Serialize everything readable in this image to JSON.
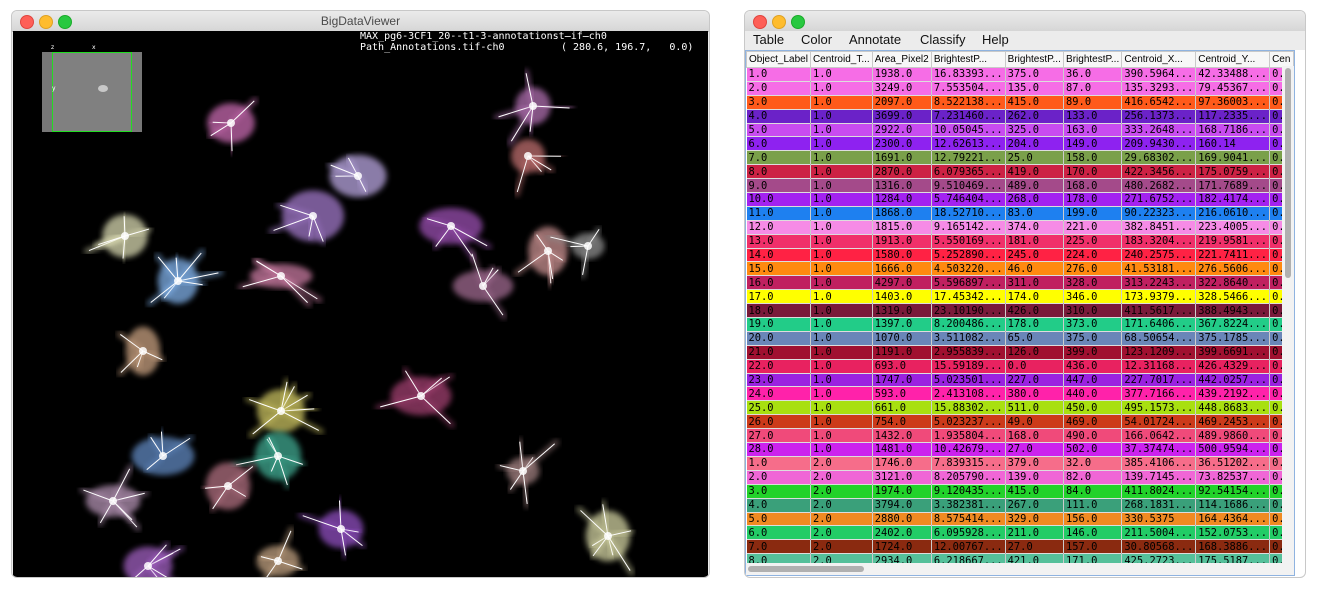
{
  "viewer": {
    "title": "BigDataViewer",
    "overlay_line1": "MAX_pg6-3CF1_20--t1-3-annotationst̶if̶ch0",
    "overlay_line2": "Path_Annotations.tif-ch0",
    "coordinates": "( 280.6, 196.7,   0.0)",
    "minimap": {
      "axis_z": "z",
      "axis_x": "x",
      "axis_y": "y"
    }
  },
  "table_window": {
    "menu": [
      "Table",
      "Color",
      "Annotate",
      "Classify",
      "Help"
    ],
    "columns": [
      "Object_Label",
      "Centroid_T...",
      "Area_Pixel2",
      "BrightestP...",
      "BrightestP...",
      "BrightestP...",
      "Centroid_X...",
      "Centroid_Y...",
      "Cen"
    ],
    "rows": [
      {
        "c": [
          "1.0",
          "1.0",
          "1938.0",
          "16.83393...",
          "375.0",
          "36.0",
          "390.5964...",
          "42.33488...",
          "0.0"
        ],
        "color": "#f66de6"
      },
      {
        "c": [
          "2.0",
          "1.0",
          "3249.0",
          "7.553504...",
          "135.0",
          "87.0",
          "135.3293...",
          "79.45367...",
          "0.0"
        ],
        "color": "#f66de6"
      },
      {
        "c": [
          "3.0",
          "1.0",
          "2097.0",
          "8.522138...",
          "415.0",
          "89.0",
          "416.6542...",
          "97.36003...",
          "0.0"
        ],
        "color": "#ff5a1a"
      },
      {
        "c": [
          "4.0",
          "1.0",
          "3699.0",
          "7.231460...",
          "262.0",
          "133.0",
          "256.1373...",
          "117.2335...",
          "0.0"
        ],
        "color": "#6b22c8"
      },
      {
        "c": [
          "5.0",
          "1.0",
          "2922.0",
          "10.05045...",
          "325.0",
          "163.0",
          "333.2648...",
          "168.7186...",
          "0.0"
        ],
        "color": "#c84cf0"
      },
      {
        "c": [
          "6.0",
          "1.0",
          "2300.0",
          "12.62613...",
          "204.0",
          "149.0",
          "209.9430...",
          "160.14",
          "0.0"
        ],
        "color": "#8e22f0"
      },
      {
        "c": [
          "7.0",
          "1.0",
          "1691.0",
          "12.79221...",
          "25.0",
          "158.0",
          "29.68302...",
          "169.9041...",
          "0.0"
        ],
        "color": "#7aa04a"
      },
      {
        "c": [
          "8.0",
          "1.0",
          "2870.0",
          "6.079365...",
          "419.0",
          "170.0",
          "422.3456...",
          "175.0759...",
          "0.0"
        ],
        "color": "#cc2244"
      },
      {
        "c": [
          "9.0",
          "1.0",
          "1316.0",
          "9.510469...",
          "489.0",
          "168.0",
          "480.2682...",
          "171.7689...",
          "0.0"
        ],
        "color": "#a44a8a"
      },
      {
        "c": [
          "10.0",
          "1.0",
          "1284.0",
          "5.746404...",
          "268.0",
          "178.0",
          "271.6752...",
          "182.4174...",
          "0.0"
        ],
        "color": "#a322f0"
      },
      {
        "c": [
          "11.0",
          "1.0",
          "1868.0",
          "18.52710...",
          "83.0",
          "199.0",
          "90.22323...",
          "216.0610...",
          "0.0"
        ],
        "color": "#1e80f0"
      },
      {
        "c": [
          "12.0",
          "1.0",
          "1815.0",
          "9.165142...",
          "374.0",
          "221.0",
          "382.8451...",
          "223.4005...",
          "0.0"
        ],
        "color": "#f68be6"
      },
      {
        "c": [
          "13.0",
          "1.0",
          "1913.0",
          "5.550169...",
          "181.0",
          "225.0",
          "183.3204...",
          "219.9581...",
          "0.0"
        ],
        "color": "#f0306a"
      },
      {
        "c": [
          "14.0",
          "1.0",
          "1580.0",
          "5.252890...",
          "245.0",
          "224.0",
          "240.2575...",
          "221.7411...",
          "0.0"
        ],
        "color": "#ff2244"
      },
      {
        "c": [
          "15.0",
          "1.0",
          "1666.0",
          "4.503220...",
          "46.0",
          "276.0",
          "41.53181...",
          "276.5606...",
          "0.0"
        ],
        "color": "#ff8a10"
      },
      {
        "c": [
          "16.0",
          "1.0",
          "4297.0",
          "5.596897...",
          "311.0",
          "328.0",
          "313.2243...",
          "322.8640...",
          "0.0"
        ],
        "color": "#c02060"
      },
      {
        "c": [
          "17.0",
          "1.0",
          "1403.0",
          "17.45342...",
          "174.0",
          "346.0",
          "173.9379...",
          "328.5466...",
          "0.0"
        ],
        "color": "#ffff00"
      },
      {
        "c": [
          "18.0",
          "1.0",
          "1319.0",
          "23.10190...",
          "426.0",
          "310.0",
          "411.5617...",
          "388.4943...",
          "0.0"
        ],
        "color": "#7a1a3a"
      },
      {
        "c": [
          "19.0",
          "1.0",
          "1397.0",
          "8.200486...",
          "178.0",
          "373.0",
          "171.6406...",
          "367.8224...",
          "0.0"
        ],
        "color": "#22cc88"
      },
      {
        "c": [
          "20.0",
          "1.0",
          "1070.0",
          "3.511082...",
          "65.0",
          "375.0",
          "68.50654...",
          "375.1785...",
          "0.0"
        ],
        "color": "#6a86b8"
      },
      {
        "c": [
          "21.0",
          "1.0",
          "1191.0",
          "2.955839...",
          "126.0",
          "399.0",
          "123.1209...",
          "399.6691...",
          "0.0"
        ],
        "color": "#a01030"
      },
      {
        "c": [
          "22.0",
          "1.0",
          "693.0",
          "15.59189...",
          "0.0",
          "436.0",
          "12.31168...",
          "426.4329...",
          "0.0"
        ],
        "color": "#e82260"
      },
      {
        "c": [
          "23.0",
          "1.0",
          "1747.0",
          "5.023501...",
          "227.0",
          "447.0",
          "227.7017...",
          "442.0257...",
          "0.0"
        ],
        "color": "#9a22e0"
      },
      {
        "c": [
          "24.0",
          "1.0",
          "593.0",
          "2.413108...",
          "380.0",
          "440.0",
          "377.7166...",
          "439.2192...",
          "0.0"
        ],
        "color": "#ff22aa"
      },
      {
        "c": [
          "25.0",
          "1.0",
          "661.0",
          "15.88302...",
          "511.0",
          "450.0",
          "495.1573...",
          "448.8683...",
          "0.0"
        ],
        "color": "#a8e010"
      },
      {
        "c": [
          "26.0",
          "1.0",
          "754.0",
          "5.023237...",
          "49.0",
          "469.0",
          "54.01724...",
          "469.2453...",
          "0.0"
        ],
        "color": "#cc3a1a"
      },
      {
        "c": [
          "27.0",
          "1.0",
          "1432.0",
          "1.935804...",
          "168.0",
          "490.0",
          "166.0642...",
          "489.9860...",
          "0.0"
        ],
        "color": "#f04a7a"
      },
      {
        "c": [
          "28.0",
          "1.0",
          "1481.0",
          "10.42679...",
          "27.0",
          "502.0",
          "37.37474...",
          "500.9594...",
          "0.0"
        ],
        "color": "#cc22ee"
      },
      {
        "c": [
          "1.0",
          "2.0",
          "1746.0",
          "7.839315...",
          "379.0",
          "32.0",
          "385.4106...",
          "36.51202...",
          "0.0"
        ],
        "color": "#f66d8a"
      },
      {
        "c": [
          "2.0",
          "2.0",
          "3121.0",
          "8.205790...",
          "139.0",
          "82.0",
          "139.7145...",
          "73.82537...",
          "0.0"
        ],
        "color": "#f066d6"
      },
      {
        "c": [
          "3.0",
          "2.0",
          "1974.0",
          "9.120435...",
          "415.0",
          "84.0",
          "411.8024...",
          "92.54154...",
          "0.0"
        ],
        "color": "#22d22a"
      },
      {
        "c": [
          "4.0",
          "2.0",
          "3794.0",
          "3.382381...",
          "267.0",
          "111.0",
          "268.1831...",
          "114.1686...",
          "0.0"
        ],
        "color": "#3aa07a"
      },
      {
        "c": [
          "5.0",
          "2.0",
          "2880.0",
          "8.575414...",
          "329.0",
          "156.0",
          "330.5375",
          "164.4364...",
          "0.0"
        ],
        "color": "#f08a22"
      },
      {
        "c": [
          "6.0",
          "2.0",
          "2402.0",
          "6.095928...",
          "211.0",
          "146.0",
          "211.5004...",
          "152.0753...",
          "0.0"
        ],
        "color": "#22cc66"
      },
      {
        "c": [
          "7.0",
          "2.0",
          "1724.0",
          "12.00767...",
          "27.0",
          "157.0",
          "30.80568...",
          "168.3886...",
          "0.0"
        ],
        "color": "#8a2a10"
      },
      {
        "c": [
          "8.0",
          "2.0",
          "2934.0",
          "6.218667...",
          "421.0",
          "171.0",
          "425.2723...",
          "175.5187...",
          "0.0"
        ],
        "color": "#55c09a"
      }
    ]
  }
}
